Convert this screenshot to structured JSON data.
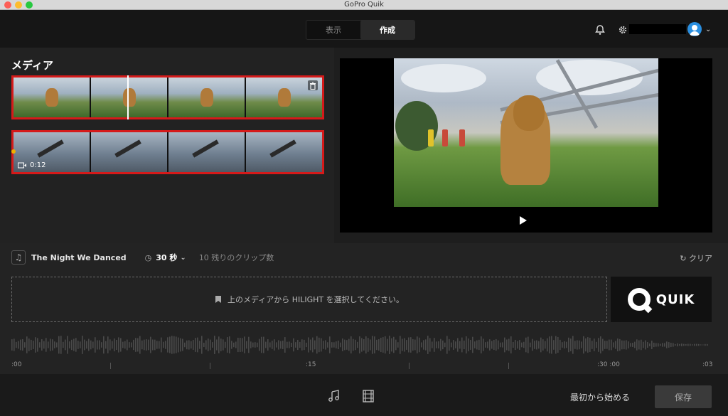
{
  "window": {
    "title": "GoPro Quik"
  },
  "header": {
    "tabs": [
      {
        "label": "表示",
        "active": false
      },
      {
        "label": "作成",
        "active": true
      }
    ],
    "icons": [
      "bell-icon",
      "gear-icon",
      "avatar"
    ]
  },
  "media": {
    "title": "メディア",
    "clips": [
      {
        "kind": "photo-burst",
        "selected": true
      },
      {
        "kind": "video",
        "duration": "0:12",
        "selected": true
      }
    ]
  },
  "music": {
    "song": "The Night We Danced",
    "duration": "30 秒",
    "remaining": "10 残りのクリップ数",
    "clear": "クリア"
  },
  "dropzone": {
    "text": "上のメディアから HILIGHT を選択してください。"
  },
  "logo": {
    "text": "QUIK"
  },
  "timeline": {
    "labels": [
      ":00",
      ":15",
      ":30 :00",
      ":03"
    ]
  },
  "footer": {
    "start": "最初から始める",
    "save": "保存"
  },
  "colors": {
    "selection_border": "#d51a1a",
    "avatar": "#2a8fe0",
    "marker": "#f0b000"
  }
}
